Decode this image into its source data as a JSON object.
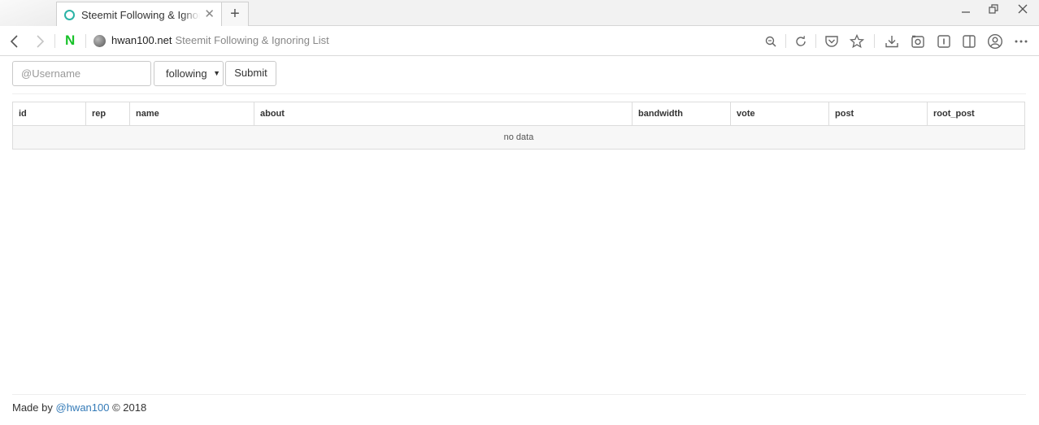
{
  "browser": {
    "tab": {
      "title": "Steemit Following & Ignoring List"
    },
    "address": {
      "host": "hwan100.net",
      "page_title": "Steemit Following & Ignoring List"
    }
  },
  "form": {
    "username_placeholder": "@Username",
    "type_selected": "following",
    "submit_label": "Submit"
  },
  "table": {
    "columns": [
      "id",
      "rep",
      "name",
      "about",
      "bandwidth",
      "vote",
      "post",
      "root_post"
    ],
    "empty_text": "no data"
  },
  "footer": {
    "prefix": "Made by",
    "author": "@hwan100",
    "suffix": "© 2018"
  },
  "icons": {
    "tab_status": "loading-circle-icon",
    "brand": "naver-n-icon"
  },
  "colors": {
    "tab_favicon": "#2bb3a6",
    "naver_green": "#19c22a",
    "link": "#337ab7"
  }
}
